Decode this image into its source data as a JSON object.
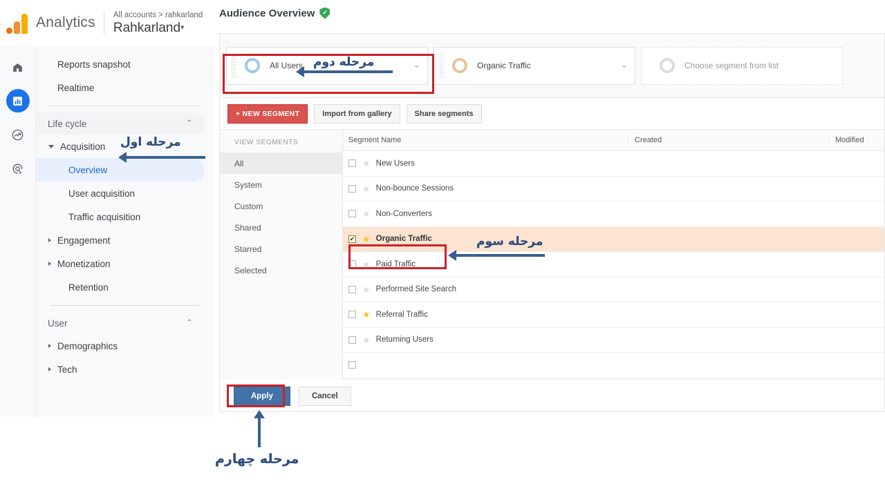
{
  "brand": {
    "name": "Analytics",
    "logo_icon": "google-analytics-logo",
    "breadcrumb": "All accounts > rahkarland",
    "account_name": "Rahkarland",
    "account_caret": "▾"
  },
  "rail": [
    {
      "name": "home",
      "glyph": "⌂"
    },
    {
      "name": "reports",
      "glyph": "▯",
      "active": true
    },
    {
      "name": "explore",
      "glyph": "◔"
    },
    {
      "name": "advertising",
      "glyph": "◎"
    }
  ],
  "sidebar": {
    "items": [
      {
        "label": "Reports snapshot",
        "type": "item"
      },
      {
        "label": "Realtime",
        "type": "item"
      },
      {
        "label": "Life cycle",
        "type": "group",
        "chevron": "⌃"
      },
      {
        "label": "Acquisition",
        "type": "item-tri-open"
      },
      {
        "label": "Overview",
        "type": "sub",
        "selected": true
      },
      {
        "label": "User acquisition",
        "type": "sub"
      },
      {
        "label": "Traffic acquisition",
        "type": "sub"
      },
      {
        "label": "Engagement",
        "type": "item-tri"
      },
      {
        "label": "Monetization",
        "type": "item-tri"
      },
      {
        "label": "Retention",
        "type": "sub"
      },
      {
        "label": "User",
        "type": "group",
        "chevron": "⌃"
      },
      {
        "label": "Demographics",
        "type": "item-tri"
      },
      {
        "label": "Tech",
        "type": "item-tri"
      }
    ]
  },
  "main": {
    "title": "Audience Overview",
    "title_badge_icon": "green-shield-check",
    "badge_check": "✓"
  },
  "segment_chips": [
    {
      "label": "All Users",
      "donut": "blue",
      "caret": "⌄"
    },
    {
      "label": "Organic Traffic",
      "donut": "orange",
      "caret": "⌄"
    },
    {
      "label": "Choose segment from list",
      "donut": "grey",
      "placeholder": true
    }
  ],
  "picker": {
    "toolbar": {
      "new_segment": "+ NEW SEGMENT",
      "import_gallery": "Import from gallery",
      "share_segments": "Share segments"
    },
    "views_header": "VIEW SEGMENTS",
    "views": [
      {
        "label": "All",
        "active": true
      },
      {
        "label": "System"
      },
      {
        "label": "Custom"
      },
      {
        "label": "Shared"
      },
      {
        "label": "Starred"
      },
      {
        "label": "Selected"
      }
    ],
    "columns": {
      "name": "Segment Name",
      "created": "Created",
      "modified": "Modified"
    },
    "rows": [
      {
        "name": "New Users",
        "checked": false,
        "starred": false
      },
      {
        "name": "Non-bounce Sessions",
        "checked": false,
        "starred": false
      },
      {
        "name": "Non-Converters",
        "checked": false,
        "starred": false
      },
      {
        "name": "Organic Traffic",
        "checked": true,
        "starred": true,
        "highlighted": true
      },
      {
        "name": "Paid Traffic",
        "checked": false,
        "starred": false
      },
      {
        "name": "Performed Site Search",
        "checked": false,
        "starred": false
      },
      {
        "name": "Referral Traffic",
        "checked": false,
        "starred": true
      },
      {
        "name": "Returning Users",
        "checked": false,
        "starred": false
      }
    ],
    "checkmark": "✔",
    "star_glyph": "★",
    "footer": {
      "apply": "Apply",
      "cancel": "Cancel"
    }
  },
  "annotations": {
    "step1": "مرحله اول",
    "step2": "مرحله دوم",
    "step3": "مرحله سوم",
    "step4": "مرحله چهارم",
    "highlight_color": "#cc2127",
    "arrow_color": "#3a5f8f"
  }
}
